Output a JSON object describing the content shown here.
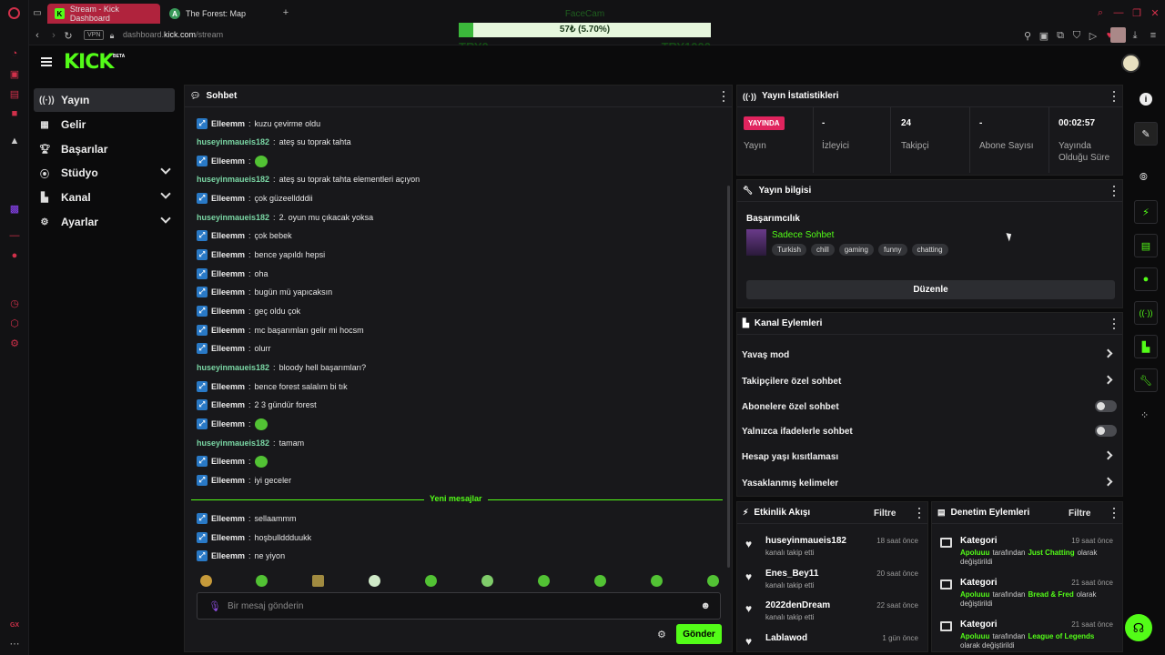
{
  "browser": {
    "tabs": [
      {
        "title": "Stream - Kick Dashboard",
        "fav": "K"
      },
      {
        "title": "The Forest: Map",
        "fav": "A"
      }
    ],
    "vpn": "VPN",
    "url": "dashboard.kick.com/stream",
    "url_host": "dashboard.",
    "url_domain": "kick.com",
    "url_path": "/stream",
    "gx_label": "GX"
  },
  "overlay": {
    "label": "FaceCam",
    "progress_text": "57₺ (5.70%)",
    "progress_fraction": 0.057,
    "min_label": "TRY0",
    "max_label": "TRY1000"
  },
  "kick": {
    "logo": "KICK",
    "beta": "BETA"
  },
  "sidebar": {
    "items": [
      {
        "label": "Yayın",
        "icon": "broadcast-icon"
      },
      {
        "label": "Gelir",
        "icon": "revenue-icon"
      },
      {
        "label": "Başarılar",
        "icon": "trophy-icon"
      },
      {
        "label": "Stüdyo",
        "icon": "studio-icon"
      },
      {
        "label": "Kanal",
        "icon": "channel-icon"
      },
      {
        "label": "Ayarlar",
        "icon": "gear-icon"
      }
    ]
  },
  "chat": {
    "title": "Sohbet",
    "messages": [
      {
        "user": "Elleemm",
        "text": "kuzu çevirme oldu",
        "badge": true
      },
      {
        "user": "huseyinmaueis182",
        "text": "ateş su toprak tahta",
        "badge": false
      },
      {
        "user": "Elleemm",
        "text": "",
        "badge": true,
        "emote": true
      },
      {
        "user": "huseyinmaueis182",
        "text": "ateş su toprak tahta elementleri açıyon",
        "badge": false
      },
      {
        "user": "Elleemm",
        "text": "çok güzeelldddii",
        "badge": true
      },
      {
        "user": "huseyinmaueis182",
        "text": "2. oyun mu çıkacak yoksa",
        "badge": false
      },
      {
        "user": "Elleemm",
        "text": "çok bebek",
        "badge": true
      },
      {
        "user": "Elleemm",
        "text": "bence yapıldı hepsi",
        "badge": true
      },
      {
        "user": "Elleemm",
        "text": "oha",
        "badge": true
      },
      {
        "user": "Elleemm",
        "text": "bugün mü yapıcaksın",
        "badge": true
      },
      {
        "user": "Elleemm",
        "text": "geç oldu çok",
        "badge": true
      },
      {
        "user": "Elleemm",
        "text": "mc başarımları gelir mi hocsm",
        "badge": true
      },
      {
        "user": "Elleemm",
        "text": "olurr",
        "badge": true
      },
      {
        "user": "huseyinmaueis182",
        "text": "bloody hell başarımları?",
        "badge": false
      },
      {
        "user": "Elleemm",
        "text": "bence forest salalım bi tık",
        "badge": true
      },
      {
        "user": "Elleemm",
        "text": "2 3 gündür forest",
        "badge": true
      },
      {
        "user": "Elleemm",
        "text": "",
        "badge": true,
        "emote": true
      },
      {
        "user": "huseyinmaueis182",
        "text": "tamam",
        "badge": false
      },
      {
        "user": "Elleemm",
        "text": "",
        "badge": true,
        "emote": true
      },
      {
        "user": "Elleemm",
        "text": "iyi geceler",
        "badge": true
      }
    ],
    "new_messages_label": "Yeni mesajlar",
    "new_messages": [
      {
        "user": "Elleemm",
        "text": "sellaammm",
        "badge": true
      },
      {
        "user": "Elleemm",
        "text": "hoşbullddduukk",
        "badge": true
      },
      {
        "user": "Elleemm",
        "text": "ne yiyon",
        "badge": true
      }
    ],
    "input_placeholder": "Bir mesaj gönderin",
    "send_label": "Gönder"
  },
  "stats": {
    "title": "Yayın İstatistikleri",
    "live_badge": "YAYINDA",
    "cells": [
      {
        "value": "",
        "label": "Yayın"
      },
      {
        "value": "-",
        "label": "İzleyici"
      },
      {
        "value": "24",
        "label": "Takipçi"
      },
      {
        "value": "-",
        "label": "Abone Sayısı"
      },
      {
        "value": "00:02:57",
        "label": "Yayında Olduğu Süre"
      }
    ]
  },
  "stream_info": {
    "title": "Yayın bilgisi",
    "stream_title": "Başarımcılık",
    "category": "Sadece Sohbet",
    "tags": [
      "Turkish",
      "chill",
      "gaming",
      "funny",
      "chatting"
    ],
    "edit_label": "Düzenle"
  },
  "channel_actions": {
    "title": "Kanal Eylemleri",
    "items": [
      {
        "label": "Yavaş mod",
        "type": "arrow"
      },
      {
        "label": "Takipçilere özel sohbet",
        "type": "arrow"
      },
      {
        "label": "Abonelere özel sohbet",
        "type": "toggle"
      },
      {
        "label": "Yalnızca ifadelerle sohbet",
        "type": "toggle"
      },
      {
        "label": "Hesap yaşı kısıtlaması",
        "type": "arrow"
      },
      {
        "label": "Yasaklanmış kelimeler",
        "type": "arrow"
      }
    ]
  },
  "activity": {
    "title": "Etkinlik Akışı",
    "filter": "Filtre",
    "items": [
      {
        "user": "huseyinmaueis182",
        "action": "kanalı takip etti",
        "time": "18 saat önce"
      },
      {
        "user": "Enes_Bey11",
        "action": "kanalı takip etti",
        "time": "20 saat önce"
      },
      {
        "user": "2022denDream",
        "action": "kanalı takip etti",
        "time": "22 saat önce"
      },
      {
        "user": "Lablawod",
        "action": "",
        "time": "1 gün önce"
      }
    ]
  },
  "moderation": {
    "title": "Denetim Eylemleri",
    "filter": "Filtre",
    "items": [
      {
        "title": "Kategori",
        "who": "Apoluuu",
        "mid": "tarafından",
        "target": "Just Chatting",
        "tail": "olarak",
        "line2": "değiştirildi",
        "time": "19 saat önce"
      },
      {
        "title": "Kategori",
        "who": "Apoluuu",
        "mid": "tarafından",
        "target": "Bread & Fred",
        "tail": "olarak",
        "line2": "değiştirildi",
        "time": "21 saat önce"
      },
      {
        "title": "Kategori",
        "who": "Apoluuu",
        "mid": "tarafından",
        "target": "League of Legends",
        "tail": "",
        "line2": "olarak değiştirildi",
        "time": "21 saat önce"
      }
    ]
  },
  "colors": {
    "kick_green": "#53fc18",
    "opera_red": "#b0233d",
    "badge_blue": "#2979c6"
  }
}
